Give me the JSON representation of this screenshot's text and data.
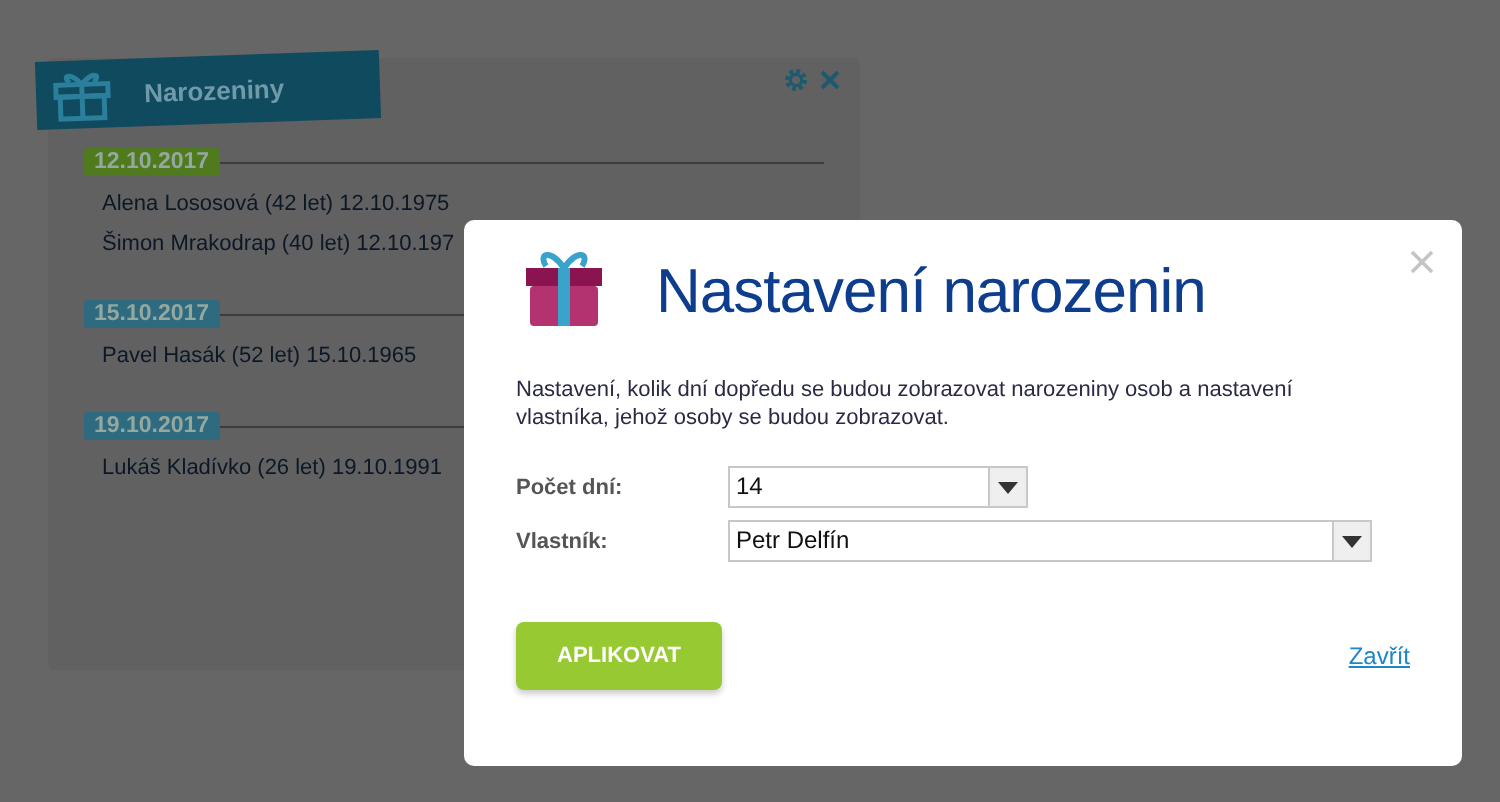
{
  "widget": {
    "title": "Narozeniny",
    "groups": [
      {
        "date": "12.10.2017",
        "color": "#4f7a1e",
        "people": [
          "Alena Lososová (42 let) 12.10.1975",
          "Šimon Mrakodrap (40 let) 12.10.197"
        ]
      },
      {
        "date": "15.10.2017",
        "color": "#2e6a80",
        "people": [
          "Pavel Hasák (52 let) 15.10.1965"
        ]
      },
      {
        "date": "19.10.2017",
        "color": "#2e6a80",
        "people": [
          "Lukáš Kladívko (26 let) 19.10.1991"
        ]
      }
    ]
  },
  "dialog": {
    "title": "Nastavení narozenin",
    "description": "Nastavení, kolik dní dopředu se budou zobrazovat narozeniny osob a nastavení vlastníka, jehož osoby se budou zobrazovat.",
    "fields": [
      {
        "label": "Počet dní:",
        "value": "14",
        "kind": "short"
      },
      {
        "label": "Vlastník:",
        "value": "Petr Delfín",
        "kind": "wide"
      }
    ],
    "apply_button": "APLIKOVAT",
    "close_link": "Zavřít"
  }
}
